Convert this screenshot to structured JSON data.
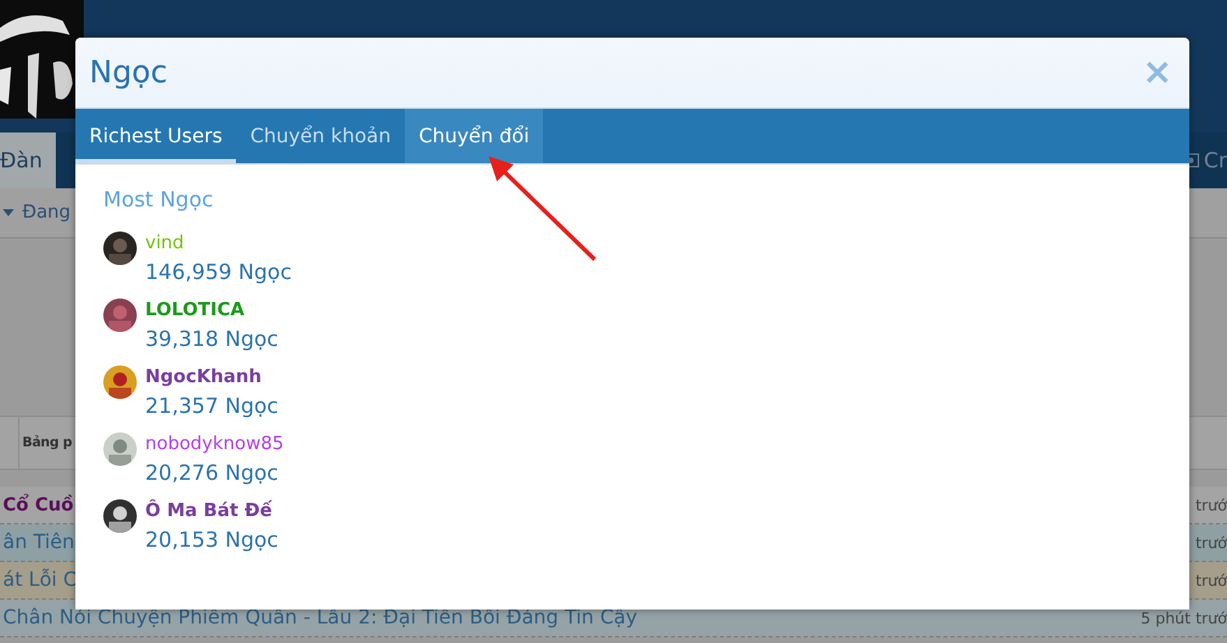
{
  "background": {
    "nav_tab": "Đàn",
    "nav_right": "Cr",
    "subnav": "Đang",
    "bar_label": "Bảng p",
    "rows": [
      {
        "title": "Cổ Cuồ",
        "time": "trướ",
        "kind": "heading"
      },
      {
        "title": "ân Tiên",
        "time": "trướ",
        "kind": "link"
      },
      {
        "title": "át Lỗi C",
        "time": "trướ",
        "kind": "link"
      },
      {
        "title": "Chân Nói Chuyện Phiếm Quần - Lầu 2: Đại Tiền Bối Đáng Tin Cậy",
        "time": "5 phút trướ",
        "kind": "link"
      }
    ]
  },
  "dialog": {
    "title": "Ngọc",
    "close": "×",
    "tabs": [
      {
        "label": "Richest Users",
        "selected": true,
        "hovered": false
      },
      {
        "label": "Chuyển khoản",
        "selected": false,
        "hovered": false
      },
      {
        "label": "Chuyển đổi",
        "selected": false,
        "hovered": true
      }
    ],
    "heading": "Most Ngọc",
    "users": [
      {
        "name": "vind",
        "amount": "146,959 Ngọc",
        "color": "#74c20c",
        "kind": "plain"
      },
      {
        "name": "LOLOTICA",
        "amount": "39,318 Ngọc",
        "color": "#1c9a1c",
        "kind": "bold"
      },
      {
        "name": "NgocKhanh",
        "amount": "21,357 Ngọc",
        "color": "#7a3e9e",
        "kind": "bold"
      },
      {
        "name": "nobodyknow85",
        "amount": "20,276 Ngọc",
        "color": "#b340e3",
        "kind": "plain"
      },
      {
        "name": "Ô Ma Bát Đế",
        "amount": "20,153 Ngọc",
        "color": "#7a3e9e",
        "kind": "bold"
      }
    ]
  }
}
